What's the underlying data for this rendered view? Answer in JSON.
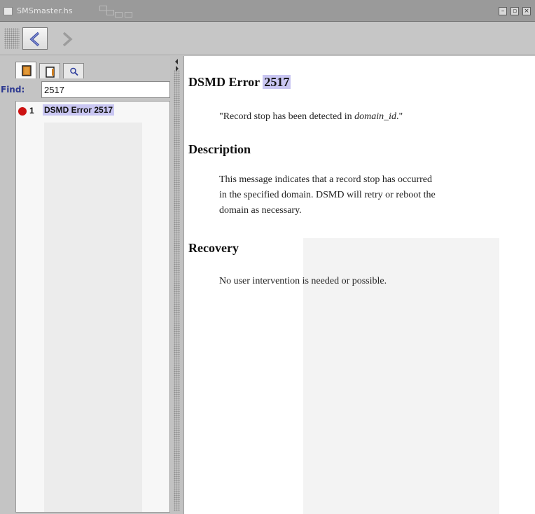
{
  "window": {
    "title": "SMSmaster.hs"
  },
  "window_buttons": {
    "minimize": "–",
    "maximize": "▫",
    "close": "×"
  },
  "toolbar": {
    "back_icon": "chevron-left-icon",
    "forward_icon": "chevron-right-icon"
  },
  "nav": {
    "tabs": [
      {
        "icon": "book-icon",
        "active": true
      },
      {
        "icon": "document-icon",
        "active": false
      },
      {
        "icon": "search-icon",
        "active": false
      }
    ],
    "find_label": "Find:",
    "find_value": "2517",
    "results": [
      {
        "number": "1",
        "title": "DSMD Error 2517",
        "status_color": "#cc1111"
      }
    ]
  },
  "article": {
    "title_prefix": "DSMD Error",
    "title_highlight": "2517",
    "summary_before": "\"Record stop has been detected in ",
    "summary_italic": "domain_id",
    "summary_after": ".\"",
    "description_heading": "Description",
    "description_lines": [
      "This message indicates that a record stop has occurred",
      "in the specified domain. DSMD will retry or reboot the",
      "domain as necessary."
    ],
    "recovery_heading": "Recovery",
    "recovery_text": "No user intervention is needed or possible."
  },
  "colors": {
    "highlight": "#c9c6f2",
    "find_label": "#2c3890",
    "status_red": "#cc1111"
  }
}
